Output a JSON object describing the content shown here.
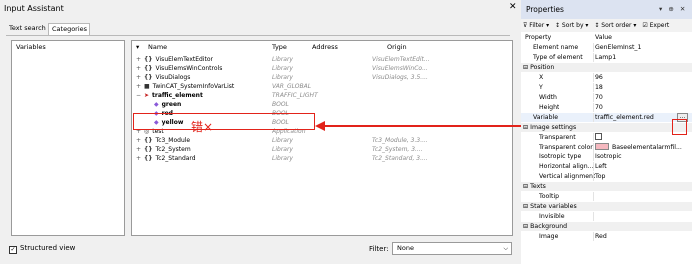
{
  "dialog": {
    "title": "Input Assistant",
    "close": "✕",
    "tabs": [
      "Text search",
      "Categories"
    ],
    "categories_header": "Variables",
    "columns": [
      "Name",
      "Type",
      "Address",
      "Origin"
    ],
    "rows": [
      {
        "exp": "+",
        "icon": "{}",
        "name": "VisuElemTextEditor",
        "type": "Library",
        "origin": "VisuElemTextEdit..."
      },
      {
        "exp": "+",
        "icon": "{}",
        "name": "VisuElemsWinControls",
        "type": "Library",
        "origin": "VisuElemsWinCo..."
      },
      {
        "exp": "+",
        "icon": "{}",
        "name": "VisuDialogs",
        "type": "Library",
        "origin": "VisuDialogs, 3.5...."
      },
      {
        "exp": "+",
        "icon": "■",
        "name": "TwinCAT_SystemInfoVarList",
        "type": "VAR_GLOBAL",
        "origin": ""
      },
      {
        "exp": "−",
        "icon": "➤",
        "name": "traffic_element",
        "type": "TRAFFIC_LIGHT",
        "origin": ""
      },
      {
        "exp": "",
        "icon": "◆",
        "name": "green",
        "type": "BOOL",
        "origin": ""
      },
      {
        "exp": "",
        "icon": "◆",
        "name": "red",
        "type": "BOOL",
        "origin": ""
      },
      {
        "exp": "",
        "icon": "◆",
        "name": "yellow",
        "type": "BOOL",
        "origin": ""
      },
      {
        "exp": "+",
        "icon": "◎",
        "name": "test",
        "type": "Application",
        "origin": ""
      },
      {
        "exp": "+",
        "icon": "{}",
        "name": "Tc3_Module",
        "type": "Library",
        "origin": "Tc3_Module, 3.3...."
      },
      {
        "exp": "+",
        "icon": "{}",
        "name": "Tc2_System",
        "type": "Library",
        "origin": "Tc2_System, 3...."
      },
      {
        "exp": "+",
        "icon": "{}",
        "name": "Tc2_Standard",
        "type": "Library",
        "origin": "Tc2_Standard, 3...."
      }
    ],
    "annotation": "错×",
    "structured_view": "Structured view",
    "filter_label": "Filter:",
    "filter_value": "None"
  },
  "properties": {
    "title": "Properties",
    "title_controls": "▾ ⊕ ✕",
    "toolbar": [
      "⊽ Filter ▾",
      "↕ Sort by ▾",
      "↕ Sort order ▾",
      "☑ Expert"
    ],
    "header": {
      "name": "Property",
      "value": "Value"
    },
    "rows": [
      {
        "kind": "sub",
        "name": "Element name",
        "value": "GenElemInst_1"
      },
      {
        "kind": "sub",
        "name": "Type of element",
        "value": "Lamp1"
      },
      {
        "kind": "cat",
        "name": "⊟ Position",
        "value": ""
      },
      {
        "kind": "sub2",
        "name": "X",
        "value": "96"
      },
      {
        "kind": "sub2",
        "name": "Y",
        "value": "18"
      },
      {
        "kind": "sub2",
        "name": "Width",
        "value": "70"
      },
      {
        "kind": "sub2",
        "name": "Height",
        "value": "70"
      },
      {
        "kind": "var",
        "name": "Variable",
        "value": "traffic_element.red"
      },
      {
        "kind": "cat",
        "name": "⊟ Image settings",
        "value": ""
      },
      {
        "kind": "sub2",
        "name": "Transparent",
        "value": ""
      },
      {
        "kind": "sub2",
        "name": "Transparent color",
        "value": "Baseelementalarmfil..."
      },
      {
        "kind": "sub2",
        "name": "Isotropic type",
        "value": "Isotropic"
      },
      {
        "kind": "sub2",
        "name": "Horizontal align...",
        "value": "Left"
      },
      {
        "kind": "sub2",
        "name": "Vertical alignment",
        "value": "Top"
      },
      {
        "kind": "cat",
        "name": "⊟ Texts",
        "value": ""
      },
      {
        "kind": "sub2",
        "name": "Tooltip",
        "value": ""
      },
      {
        "kind": "cat",
        "name": "⊟ State variables",
        "value": ""
      },
      {
        "kind": "sub2",
        "name": "Invisible",
        "value": ""
      },
      {
        "kind": "cat",
        "name": "⊟ Background",
        "value": ""
      },
      {
        "kind": "sub2",
        "name": "Image",
        "value": "Red"
      }
    ],
    "ellipsis": "..."
  },
  "colors": {
    "annotation": "#e2231a",
    "swatch": "#f5b8bf"
  }
}
